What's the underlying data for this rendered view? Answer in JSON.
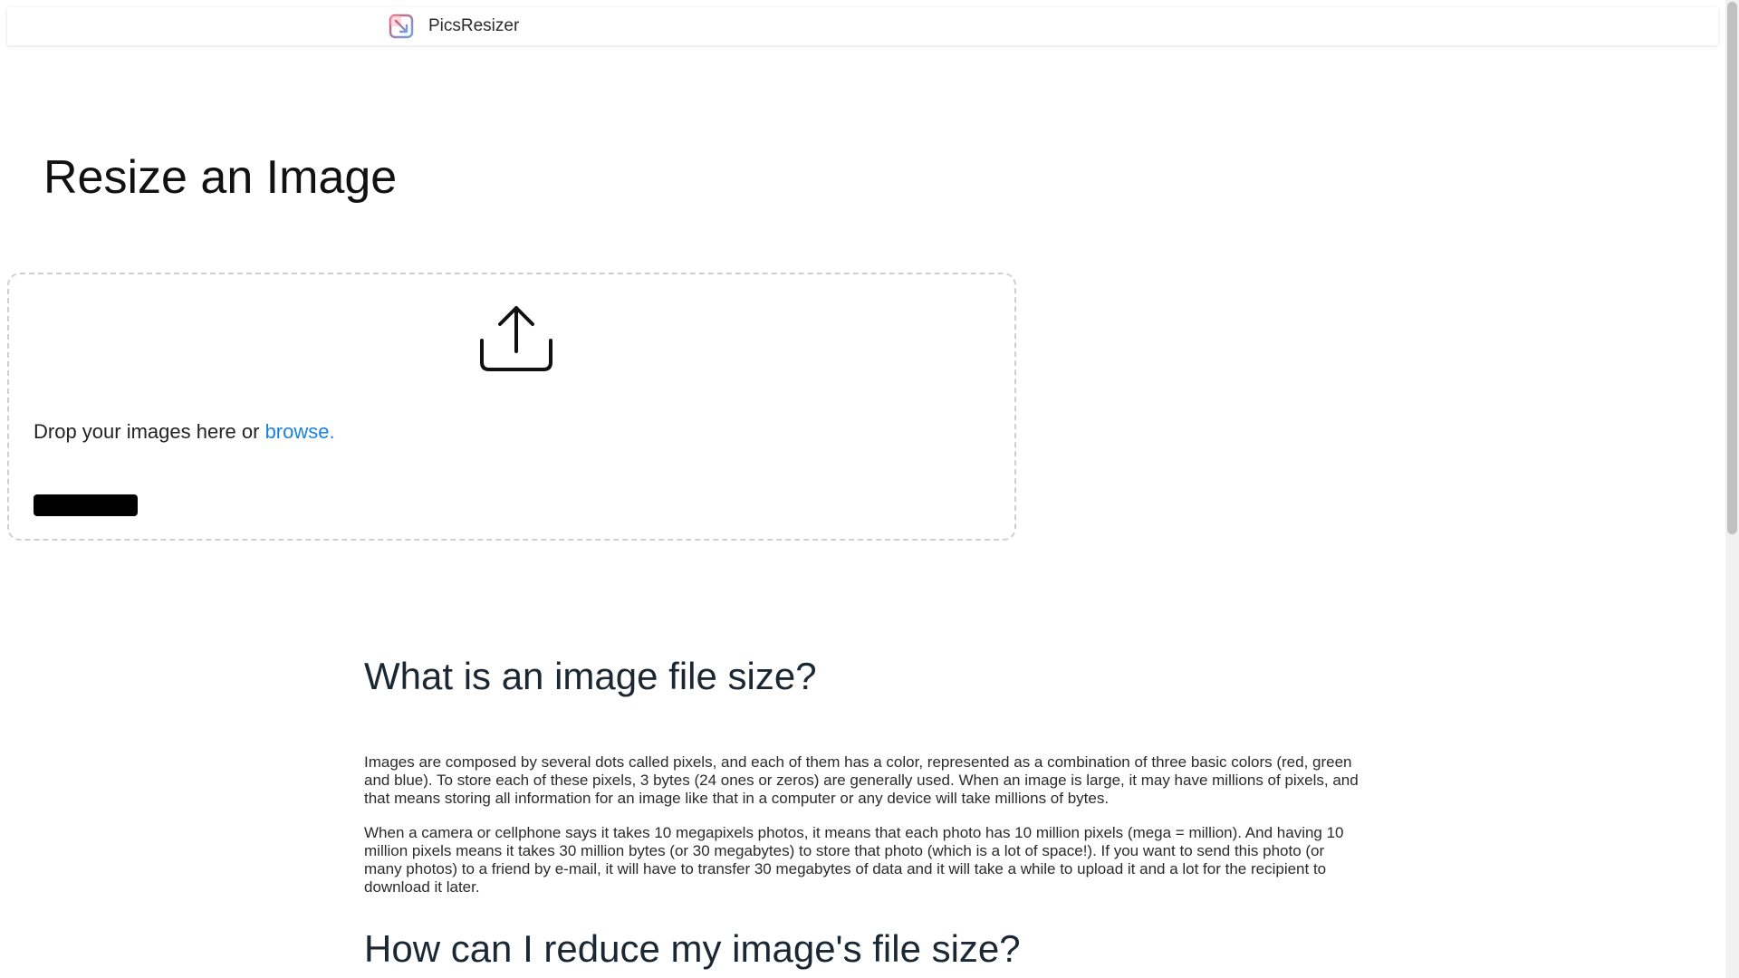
{
  "header": {
    "brand_name": "PicsResizer",
    "logo_icon": "resize-arrow-icon",
    "logo_colors": [
      "#e2566a",
      "#6aa8e0"
    ]
  },
  "main": {
    "title": "Resize an Image",
    "dropzone": {
      "icon": "upload-icon",
      "text": "Drop your images here or ",
      "browse_label": "browse.",
      "browse_color": "#1a82e2",
      "button_label": ""
    }
  },
  "article": {
    "heading_1": "What is an image file size?",
    "paragraph_1": "Images are composed by several dots called pixels, and each of them has a color, represented as a combination of three basic colors (red, green and blue). To store each of these pixels, 3 bytes (24 ones or zeros) are generally used. When an image is large, it may have millions of pixels, and that means storing all information for an image like that in a computer or any device will take millions of bytes.",
    "paragraph_2": "When a camera or cellphone says it takes 10 megapixels photos, it means that each photo has 10 million pixels (mega = million). And having 10 million pixels means it takes 30 million bytes (or 30 megabytes) to store that photo (which is a lot of space!). If you want to send this photo (or many photos) to a friend by e-mail, it will have to transfer 30 megabytes of data and it will take a while to upload it and a lot for the recipient to download it later.",
    "heading_2": "How can I reduce my image's file size?"
  }
}
